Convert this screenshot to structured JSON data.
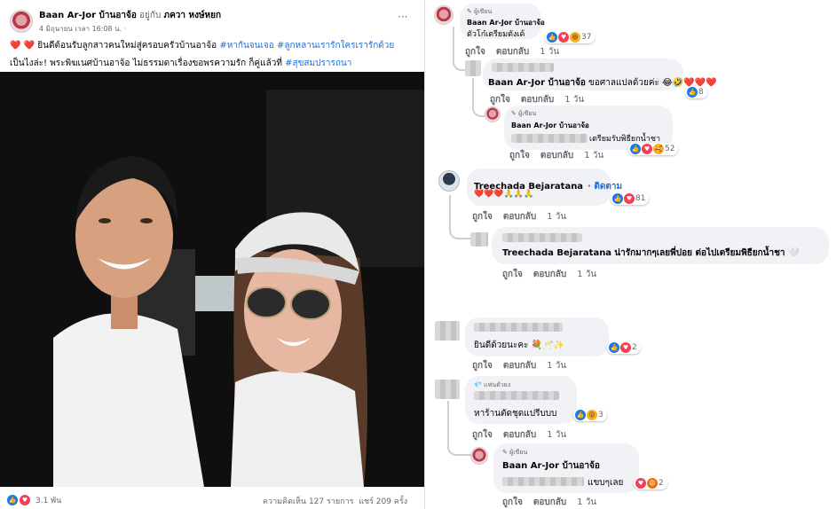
{
  "post": {
    "page_name": "Baan Ar-Jor บ้านอาจ้อ",
    "with_text": "อยู่กับ",
    "with_person": "ภควา หงษ์หยก",
    "timestamp": "4 มิถุนายน เวลา 16:08 น.",
    "privacy": "·",
    "more": "···",
    "hearts": "❤️ ❤️",
    "caption_line1": "ยินดีต้อนรับลูกสาวคนใหม่สู่ครอบครัวบ้านอาจ้อ",
    "hashtag1": "#หากันจนเจอ",
    "hashtag2": "#ลูกหลานเรารักใครเรารักด้วย",
    "caption_line2": "เป็นไงล่ะ! พระพิฆเนศบ้านอาจ้อ ไม่ธรรมดาเรื่องขอพรความรัก ก็คู่แล้วที่",
    "hashtag3": "#สุขสมปรารถนา",
    "reactions_count": "3.1 พัน",
    "comments_shares": "ความคิดเห็น 127 รายการ  แชร์ 209 ครั้ง"
  },
  "comments": [
    {
      "badge": "ผู้เขียน",
      "name": "Baan Ar-Jor บ้านอาจ้อ",
      "text": "ตัวโก๋เตรียมตังเด้",
      "count": "37",
      "like": "ถูกใจ",
      "reply": "ตอบกลับ",
      "time": "1 วัน"
    },
    {
      "name": "Baan Ar-Jor บ้านอาจ้อ",
      "text": "ขอศาลแปลด้วยค่ะ 😂🤣❤️❤️❤️",
      "count": "8",
      "like": "ถูกใจ",
      "reply": "ตอบกลับ",
      "time": "1 วัน"
    },
    {
      "badge": "ผู้เขียน",
      "name": "Baan Ar-Jor บ้านอาจ้อ",
      "text": "เตรียมรับพิธียกน้ำชา",
      "count": "52",
      "like": "ถูกใจ",
      "reply": "ตอบกลับ",
      "time": "1 วัน"
    },
    {
      "name": "Treechada Bejaratana",
      "follow": "· ติดตาม",
      "text": "❤️❤️❤️🙏🙏🙏",
      "count": "81",
      "like": "ถูกใจ",
      "reply": "ตอบกลับ",
      "time": "1 วัน"
    },
    {
      "name": "Treechada Bejaratana",
      "text": "น่ารักมากๆเลยพี่ปอย ต่อไปเตรียมพิธียกน้ำชา 🤍",
      "like": "ถูกใจ",
      "reply": "ตอบกลับ",
      "time": "1 วัน"
    },
    {
      "text": "ยินดีด้วยนะคะ 💐🥂✨",
      "count": "2",
      "like": "ถูกใจ",
      "reply": "ตอบกลับ",
      "time": "1 วัน"
    },
    {
      "badge": "แฟนตัวยง",
      "text": "หาร้านตัดชุดแปรีบบบ",
      "count": "3",
      "like": "ถูกใจ",
      "reply": "ตอบกลับ",
      "time": "1 วัน"
    },
    {
      "badge": "ผู้เขียน",
      "name": "Baan Ar-Jor บ้านอาจ้อ",
      "text": "แขบๆเลย",
      "count": "2",
      "like": "ถูกใจ",
      "reply": "ตอบกลับ",
      "time": "1 วัน"
    }
  ]
}
